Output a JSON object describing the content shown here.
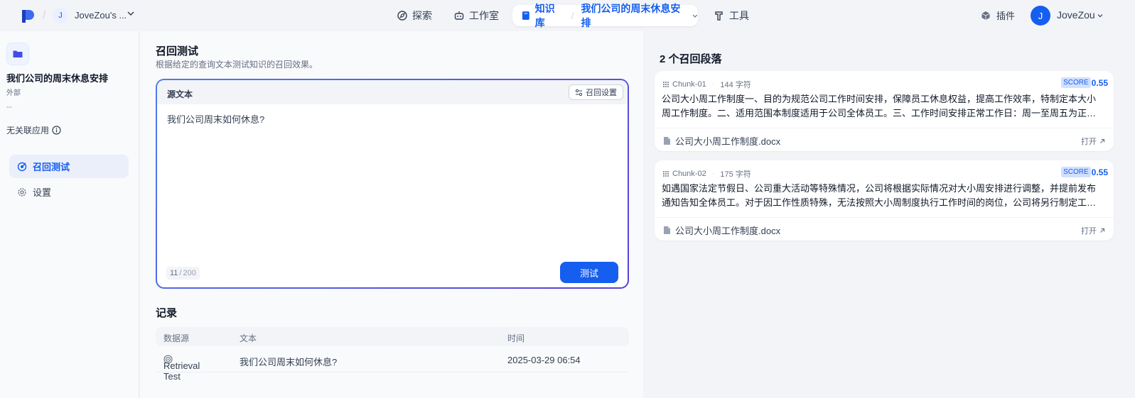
{
  "topbar": {
    "workspace_initial": "J",
    "workspace_name": "JoveZou's ...",
    "nav": {
      "explore": "探索",
      "studio": "工作室",
      "knowledge": "知识库",
      "dataset": "我们公司的周末休息安排",
      "tools": "工具"
    },
    "plugins": "插件",
    "user_initial": "J",
    "user_name": "JoveZou"
  },
  "sidebar": {
    "dataset_title": "我们公司的周末休息安排",
    "dataset_type": "外部",
    "description": "--",
    "no_apps": "无关联应用",
    "menu": [
      {
        "label": "召回测试"
      },
      {
        "label": "设置"
      }
    ]
  },
  "main": {
    "title": "召回测试",
    "description": "根据给定的查询文本测试知识的召回效果。",
    "source_label": "源文本",
    "settings_label": "召回设置",
    "query": "我们公司周末如何休息?",
    "count": "11",
    "count_sep": "/",
    "count_max": "200",
    "test_button": "测试",
    "records": {
      "title": "记录",
      "headers": [
        "数据源",
        "文本",
        "时间"
      ],
      "rows": [
        {
          "source": "Retrieval Test",
          "text": "我们公司周末如何休息?",
          "time": "2025-03-29 06:54"
        }
      ]
    }
  },
  "results": {
    "title": "2 个召回段落",
    "chunks": [
      {
        "id": "Chunk-01",
        "chars": "144 字符",
        "score_label": "SCORE",
        "score": "0.55",
        "line1": "公司大小周工作制度一、目的为规范公司工作时间安排，保障员工休息权益，提高工作效率，特制定本大小",
        "line2": "周工作制度。二、适用范围本制度适用于公司全体员工。三、工作时间安排正常工作日：周一至周五为正…",
        "file": "公司大小周工作制度.docx",
        "open": "打开"
      },
      {
        "id": "Chunk-02",
        "chars": "175 字符",
        "score_label": "SCORE",
        "score": "0.55",
        "line1": "如遇国家法定节假日、公司重大活动等特殊情况，公司将根据实际情况对大小周安排进行调整，并提前发布",
        "line2": "通知告知全体员工。对于因工作性质特殊，无法按照大小周制度执行工作时间的岗位，公司将另行制定工…",
        "file": "公司大小周工作制度.docx",
        "open": "打开"
      }
    ]
  },
  "colors": {
    "accent": "#155eef",
    "score_bg": "#d1e0ff",
    "background": "#f2f4f7"
  }
}
